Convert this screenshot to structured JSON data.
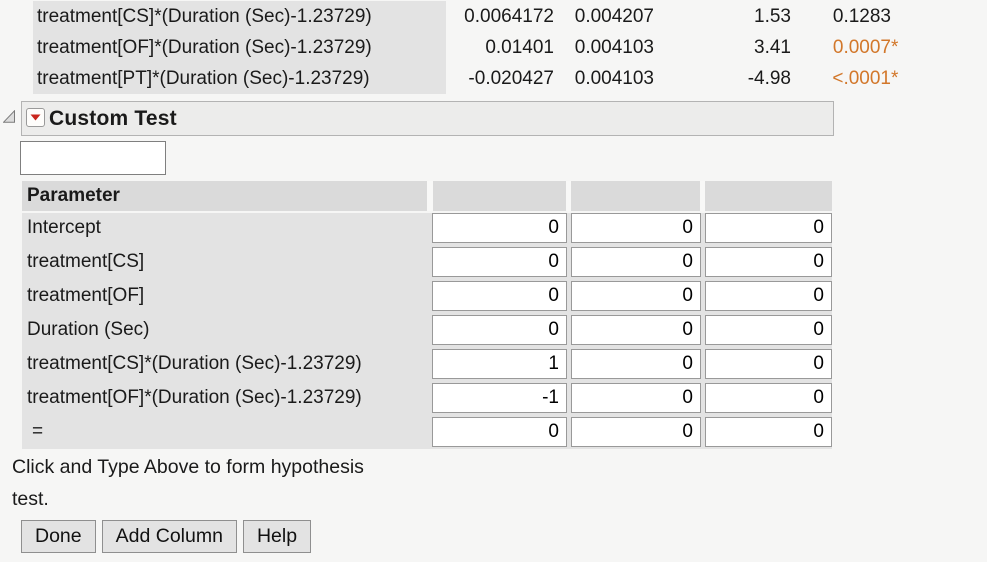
{
  "estimates": {
    "rows": [
      {
        "label": "treatment[CS]*(Duration (Sec)-1.23729)",
        "estimate": "0.0064172",
        "std_error": "0.004207",
        "t_ratio": "1.53",
        "prob": "0.1283",
        "star": "",
        "significant": false
      },
      {
        "label": "treatment[OF]*(Duration (Sec)-1.23729)",
        "estimate": "0.01401",
        "std_error": "0.004103",
        "t_ratio": "3.41",
        "prob": "0.0007",
        "star": "*",
        "significant": true
      },
      {
        "label": "treatment[PT]*(Duration (Sec)-1.23729)",
        "estimate": "-0.020427",
        "std_error": "0.004103",
        "t_ratio": "-4.98",
        "prob": "<.0001",
        "star": "*",
        "significant": true
      }
    ]
  },
  "custom_test": {
    "title": "Custom Test",
    "name_value": "",
    "param_header": "Parameter",
    "rows": [
      {
        "label": "Intercept",
        "c1": "0",
        "c2": "0",
        "c3": "0"
      },
      {
        "label": "treatment[CS]",
        "c1": "0",
        "c2": "0",
        "c3": "0"
      },
      {
        "label": "treatment[OF]",
        "c1": "0",
        "c2": "0",
        "c3": "0"
      },
      {
        "label": "Duration (Sec)",
        "c1": "0",
        "c2": "0",
        "c3": "0"
      },
      {
        "label": "treatment[CS]*(Duration (Sec)-1.23729)",
        "c1": "1",
        "c2": "0",
        "c3": "0"
      },
      {
        "label": "treatment[OF]*(Duration (Sec)-1.23729)",
        "c1": "-1",
        "c2": "0",
        "c3": "0"
      },
      {
        "label": "=",
        "c1": "0",
        "c2": "0",
        "c3": "0"
      }
    ],
    "caption_line1": "Click and Type Above to form hypothesis",
    "caption_line2": "test.",
    "buttons": {
      "done": "Done",
      "add_column": "Add Column",
      "help": "Help"
    }
  },
  "icons": {
    "disclosure": "open-disclosure-wedge",
    "menu": "red-triangle-menu"
  },
  "colors": {
    "significant_pvalue": "#d2772a",
    "table_label_bg": "#e3e3e3",
    "section_header_bg": "#ececeb",
    "parameter_header_bg": "#dadada",
    "button_bg": "#e3e3e3",
    "menu_triangle_red": "#c9251d",
    "page_bg": "#f6f6f5"
  }
}
